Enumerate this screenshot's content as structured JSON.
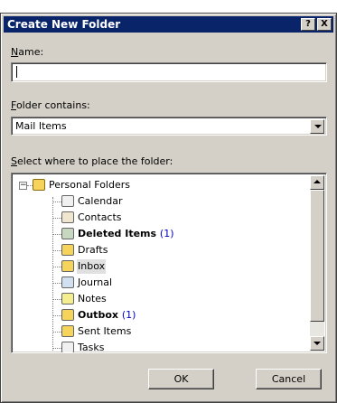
{
  "window": {
    "title": "Create New Folder",
    "help_button": "?",
    "close_button": "X"
  },
  "name_field": {
    "label_accel": "N",
    "label_rest": "ame:",
    "value": ""
  },
  "folder_contains": {
    "label_accel": "F",
    "label_rest": "older contains:",
    "selected": "Mail Items"
  },
  "location": {
    "label_accel": "S",
    "label_rest": "elect where to place the folder:",
    "root": {
      "label": "Personal Folders",
      "expander": "−",
      "icon": "personal-folders-icon"
    },
    "items": [
      {
        "label": "Calendar",
        "icon": "calendar-icon",
        "count": ""
      },
      {
        "label": "Contacts",
        "icon": "contacts-icon",
        "count": ""
      },
      {
        "label": "Deleted Items",
        "icon": "deleted-items-icon",
        "count": "(1)"
      },
      {
        "label": "Drafts",
        "icon": "drafts-icon",
        "count": ""
      },
      {
        "label": "Inbox",
        "icon": "inbox-icon",
        "count": ""
      },
      {
        "label": "Journal",
        "icon": "journal-icon",
        "count": ""
      },
      {
        "label": "Notes",
        "icon": "notes-icon",
        "count": ""
      },
      {
        "label": "Outbox",
        "icon": "outbox-icon",
        "count": "(1)"
      },
      {
        "label": "Sent Items",
        "icon": "sent-items-icon",
        "count": ""
      },
      {
        "label": "Tasks",
        "icon": "tasks-icon",
        "count": ""
      }
    ]
  },
  "buttons": {
    "ok": "OK",
    "cancel": "Cancel"
  },
  "colors": {
    "title_bar": "#0a246a",
    "dialog_face": "#d4d0c8",
    "unread_count": "#0000c0"
  }
}
